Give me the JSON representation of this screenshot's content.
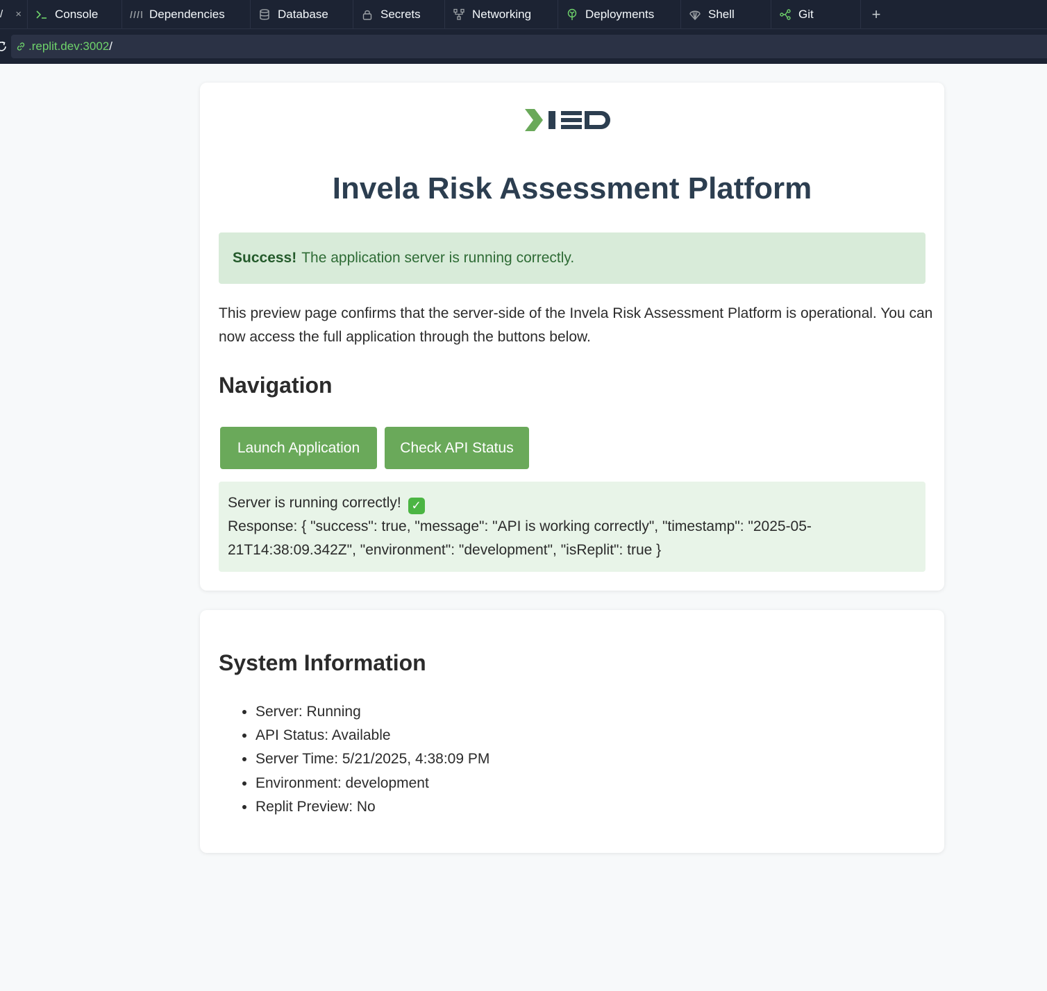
{
  "ide": {
    "tabs": [
      {
        "label": "Console",
        "icon": "console-icon"
      },
      {
        "label": "Dependencies",
        "icon": "dependencies-icon"
      },
      {
        "label": "Database",
        "icon": "database-icon"
      },
      {
        "label": "Secrets",
        "icon": "lock-icon"
      },
      {
        "label": "Networking",
        "icon": "networking-icon"
      },
      {
        "label": "Deployments",
        "icon": "deployments-icon"
      },
      {
        "label": "Shell",
        "icon": "shell-icon"
      },
      {
        "label": "Git",
        "icon": "git-icon"
      }
    ],
    "add_tab_label": "+",
    "close_label": "×",
    "url_host": ".replit.dev:3002",
    "url_path": "/"
  },
  "page": {
    "title": "Invela Risk Assessment Platform",
    "alert_strong": "Success!",
    "alert_text": "The application server is running correctly.",
    "intro": "This preview page confirms that the server-side of the Invela Risk Assessment Platform is operational. You can now access the full application through the buttons below.",
    "nav_heading": "Navigation",
    "launch_button": "Launch Application",
    "api_button": "Check API Status",
    "result_line1": "Server is running correctly!",
    "result_line2": "Response: { \"success\": true, \"message\": \"API is working correctly\", \"timestamp\": \"2025-05-21T14:38:09.342Z\", \"environment\": \"development\", \"isReplit\": true }",
    "system_heading": "System Information",
    "system_items": [
      "Server: Running",
      "API Status: Available",
      "Server Time: 5/21/2025, 4:38:09 PM",
      "Environment: development",
      "Replit Preview: No"
    ]
  },
  "colors": {
    "brand_green": "#6aa95a",
    "brand_navy": "#2c3e50",
    "ide_bg": "#1c2333",
    "url_green": "#6fd36b"
  }
}
